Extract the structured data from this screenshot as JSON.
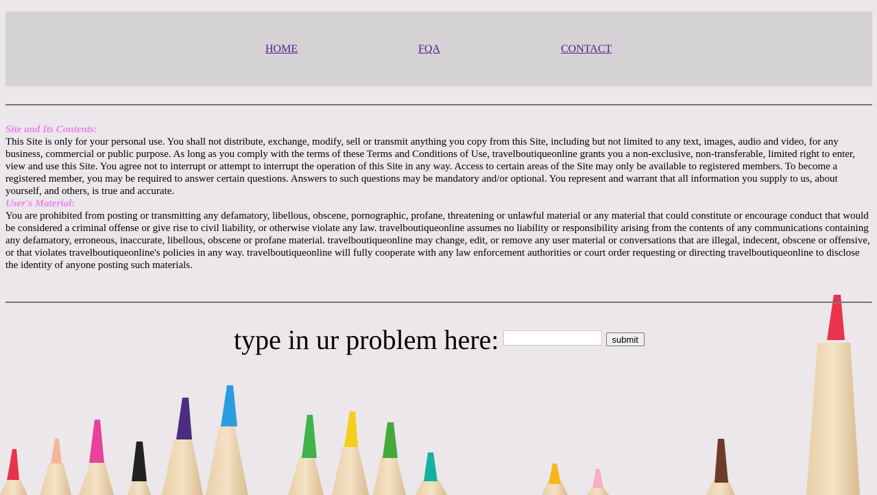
{
  "nav": {
    "home": "HOME",
    "fqa": "FQA",
    "contact": "CONTACT"
  },
  "sections": [
    {
      "heading": "Site and Its Contents:",
      "body": "This Site is only for your personal use. You shall not distribute, exchange, modify, sell or transmit anything you copy from this Site, including but not limited to any text, images, audio and video, for any business, commercial or public purpose. As long as you comply with the terms of these Terms and Conditions of Use, travelboutiqueonline grants you a non-exclusive, non-transferable, limited right to enter, view and use this Site. You agree not to interrupt or attempt to interrupt the operation of this Site in any way. Access to certain areas of the Site may only be available to registered members. To become a registered member, you may be required to answer certain questions. Answers to such questions may be mandatory and/or optional. You represent and warrant that all information you supply to us, about yourself, and others, is true and accurate."
    },
    {
      "heading": "User's Material:",
      "body": "You are prohibited from posting or transmitting any defamatory, libellous, obscene, pornographic, profane, threatening or unlawful material or any material that could constitute or encourage conduct that would be considered a criminal offense or give rise to civil liability, or otherwise violate any law. travelboutiqueonline assumes no liability or responsibility arising from the contents of any communications containing any defamatory, erroneous, inaccurate, libellous, obscene or profane material. travelboutiqueonline may change, edit, or remove any user material or conversations that are illegal, indecent, obscene or offensive, or that violates travelboutiqueonline's policies in any way. travelboutiqueonline will fully cooperate with any law enforcement authorities or court order requesting or directing travelboutiqueonline to disclose the identity of anyone posting such materials."
    }
  ],
  "form": {
    "label": "type in ur problem here:",
    "input_value": "",
    "submit_label": "submit"
  },
  "colors": {
    "heading": "#ee82ee",
    "link": "#551a8b",
    "nav_bg": "#d4d2d5",
    "page_bg": "#ebe7eb"
  }
}
